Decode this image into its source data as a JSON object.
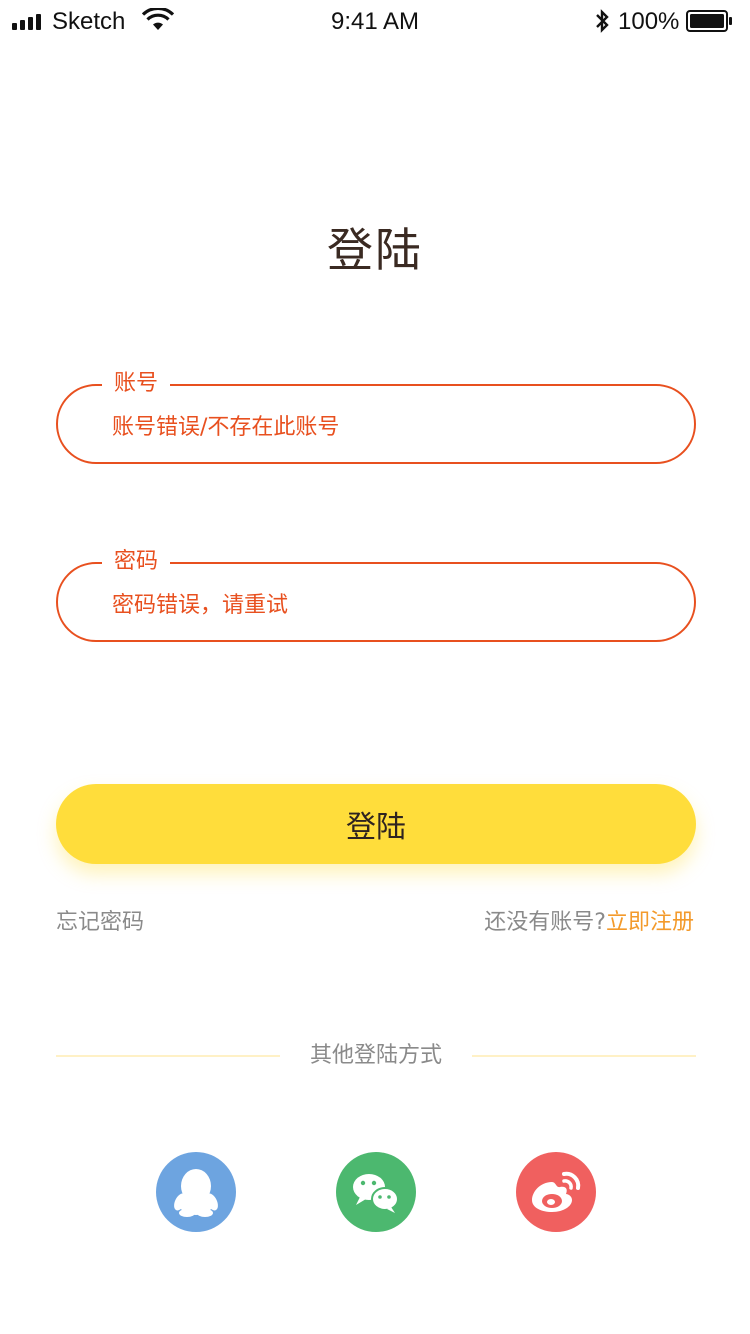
{
  "status_bar": {
    "carrier": "Sketch",
    "time": "9:41 AM",
    "battery": "100%",
    "icons": [
      "signal-icon",
      "wifi-icon",
      "bluetooth-icon",
      "battery-icon"
    ]
  },
  "page": {
    "title": "登陆"
  },
  "form": {
    "account": {
      "label": "账号",
      "value": "账号错误/不存在此账号"
    },
    "password": {
      "label": "密码",
      "value": "密码错误，请重试"
    },
    "login_label": "登陆"
  },
  "links": {
    "forgot_password": "忘记密码",
    "no_account": "还没有账号?",
    "register": "立即注册"
  },
  "other_login": {
    "label": "其他登陆方式",
    "providers": [
      "qq-icon",
      "wechat-icon",
      "weibo-icon"
    ]
  },
  "colors": {
    "accent": "#e8501f",
    "button": "#ffdd3b",
    "register_link": "#f39a2b",
    "qq": "#6da4e0",
    "wechat": "#4cb86f",
    "weibo": "#f0605f"
  }
}
